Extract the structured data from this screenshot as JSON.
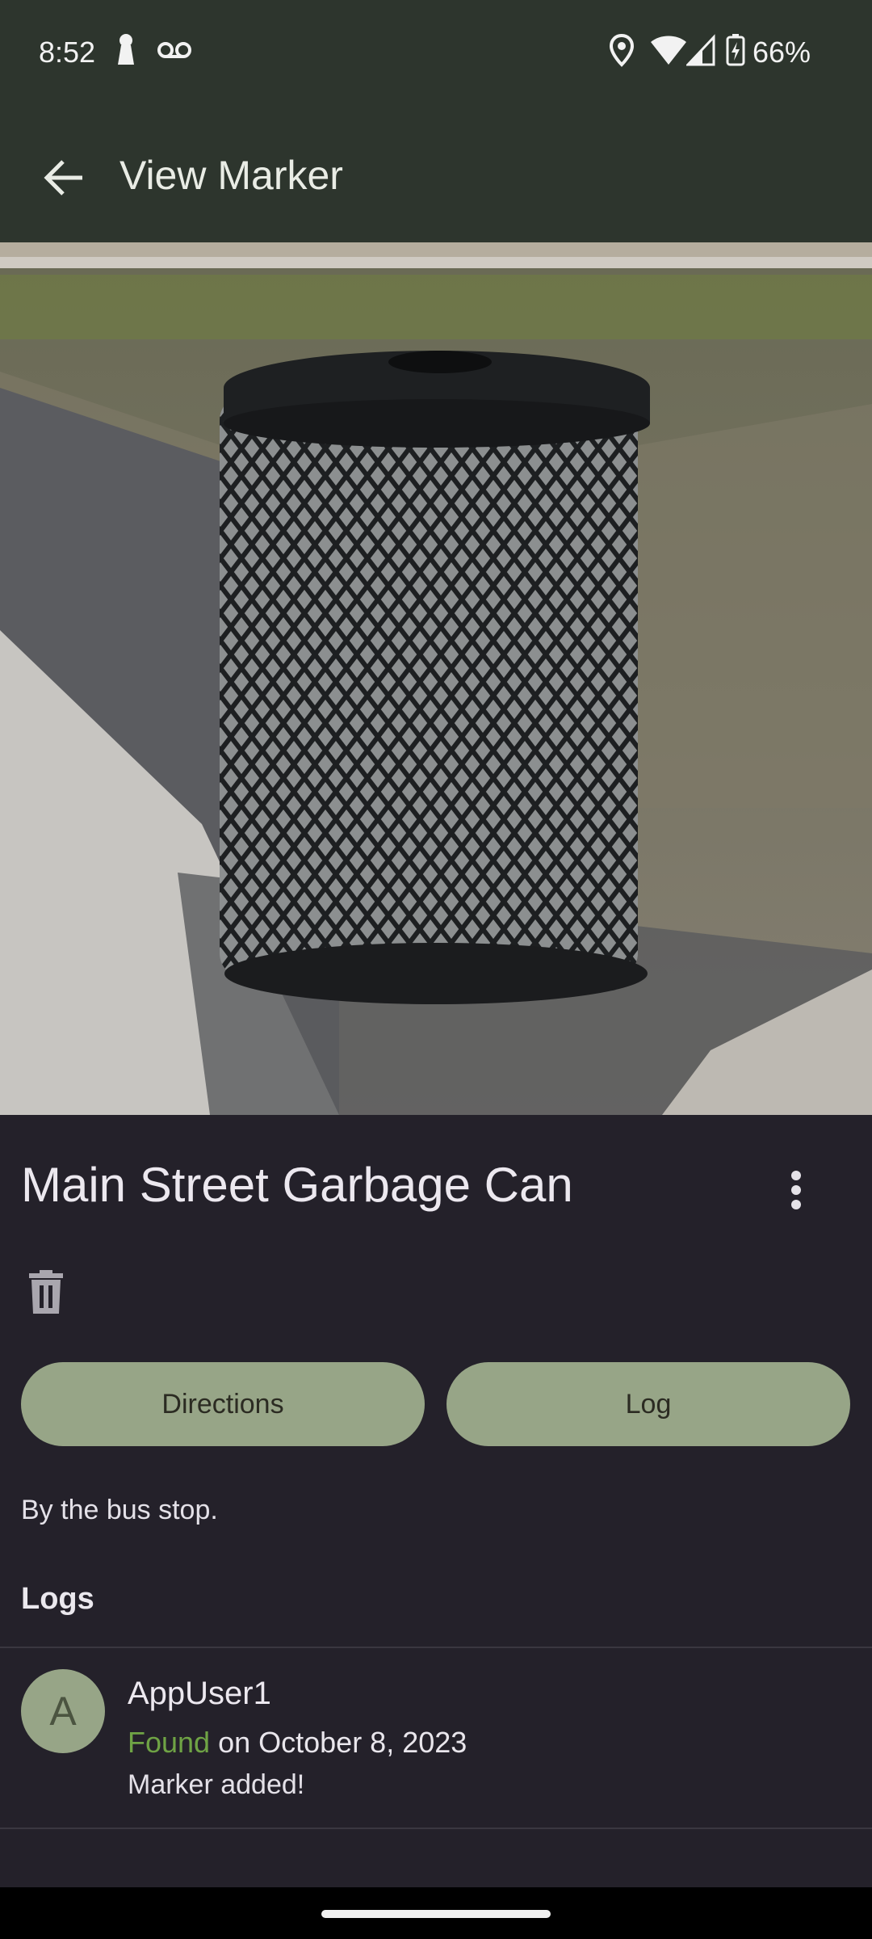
{
  "status_bar": {
    "time": "8:52",
    "battery": "66%",
    "icons": [
      "keyhole-icon",
      "voicemail-icon",
      "location-icon",
      "wifi-icon",
      "signal-icon",
      "battery-charging-icon"
    ]
  },
  "app_bar": {
    "title": "View Marker",
    "back_icon": "arrow-back-icon"
  },
  "photo": {
    "subject": "black mesh garbage can on gravel by sidewalk"
  },
  "marker": {
    "name": "Main Street Garbage Can",
    "more_icon": "more-vert-icon",
    "delete_icon": "trash-icon",
    "description": "By the bus stop."
  },
  "actions": {
    "directions_label": "Directions",
    "log_label": "Log"
  },
  "logs": {
    "heading": "Logs",
    "entries": [
      {
        "avatar_letter": "A",
        "user": "AppUser1",
        "status": "Found",
        "date_text": " on October 8, 2023",
        "message": "Marker added!"
      }
    ]
  },
  "colors": {
    "header": "#2d352d",
    "background": "#24212a",
    "button": "#97a587",
    "found": "#6fa345"
  }
}
